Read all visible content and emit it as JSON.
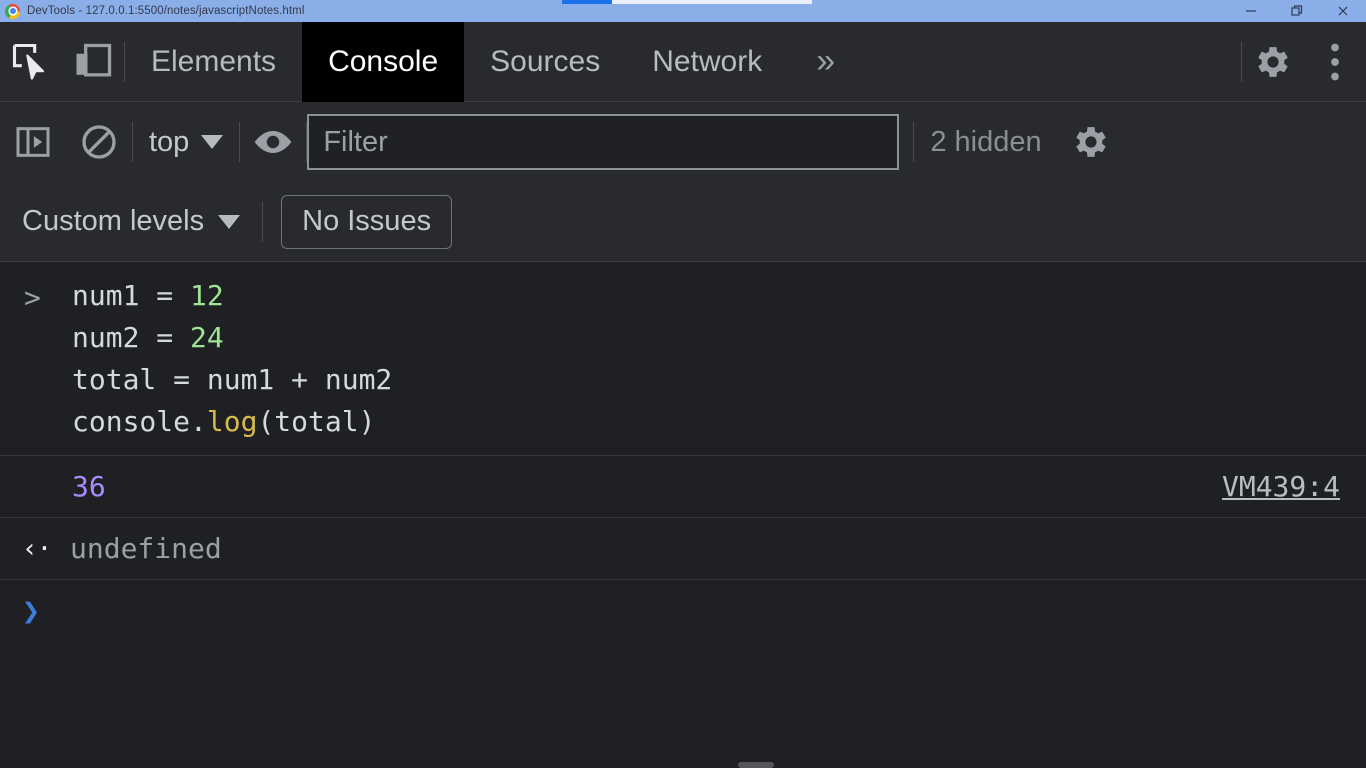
{
  "titlebar": {
    "app_icon": "chrome-logo",
    "title": "DevTools - 127.0.0.1:5500/notes/javascriptNotes.html",
    "background_color": "#8aaee8",
    "progress": {
      "percent": 20,
      "fill_color": "#1a73e8",
      "track_color": "#e9eef8"
    },
    "controls": [
      {
        "name": "minimize",
        "glyph": "—"
      },
      {
        "name": "maximize",
        "glyph": "❐"
      },
      {
        "name": "close",
        "glyph": "✕"
      }
    ]
  },
  "tabbar": {
    "inspect_icon": "inspect-element-icon",
    "device_icon": "device-toolbar-icon",
    "tabs": [
      {
        "label": "Elements",
        "selected": false
      },
      {
        "label": "Console",
        "selected": true
      },
      {
        "label": "Sources",
        "selected": false
      },
      {
        "label": "Network",
        "selected": false
      }
    ],
    "more_tabs_glyph": "»",
    "settings_icon": "gear-icon",
    "menu_icon": "kebab-menu-icon",
    "selected_tab_bg": "#000000",
    "bar_bg": "#292a2d"
  },
  "filterbar": {
    "sidebar_toggle_icon": "console-sidebar-icon",
    "clear_console_icon": "clear-console-icon",
    "context": {
      "label": "top",
      "caret": "▼"
    },
    "live_expression_icon": "eye-icon",
    "filter": {
      "value": "",
      "placeholder": "Filter"
    },
    "hidden_count": "2 hidden",
    "settings_icon": "gear-icon"
  },
  "levelbar": {
    "levels": {
      "label": "Custom levels",
      "caret": "▼"
    },
    "issues_button": "No Issues"
  },
  "console": {
    "prompt_glyph": ">",
    "input_lines": [
      [
        {
          "t": "num1 = ",
          "c": "txt"
        },
        {
          "t": "12",
          "c": "num"
        }
      ],
      [
        {
          "t": "num2 = ",
          "c": "txt"
        },
        {
          "t": "24",
          "c": "num"
        }
      ],
      [
        {
          "t": "total = num1 + num2",
          "c": "txt"
        }
      ],
      [
        {
          "t": "console.",
          "c": "txt"
        },
        {
          "t": "log",
          "c": "fn"
        },
        {
          "t": "(total)",
          "c": "txt"
        }
      ]
    ],
    "output": {
      "value": "36",
      "value_color": "#a88bfa",
      "source_link": "VM439:4"
    },
    "return": {
      "arrow": "‹·",
      "value": "undefined"
    },
    "active_prompt": "❯",
    "active_prompt_color": "#3b7dd8",
    "body_bg": "#1f2023"
  }
}
